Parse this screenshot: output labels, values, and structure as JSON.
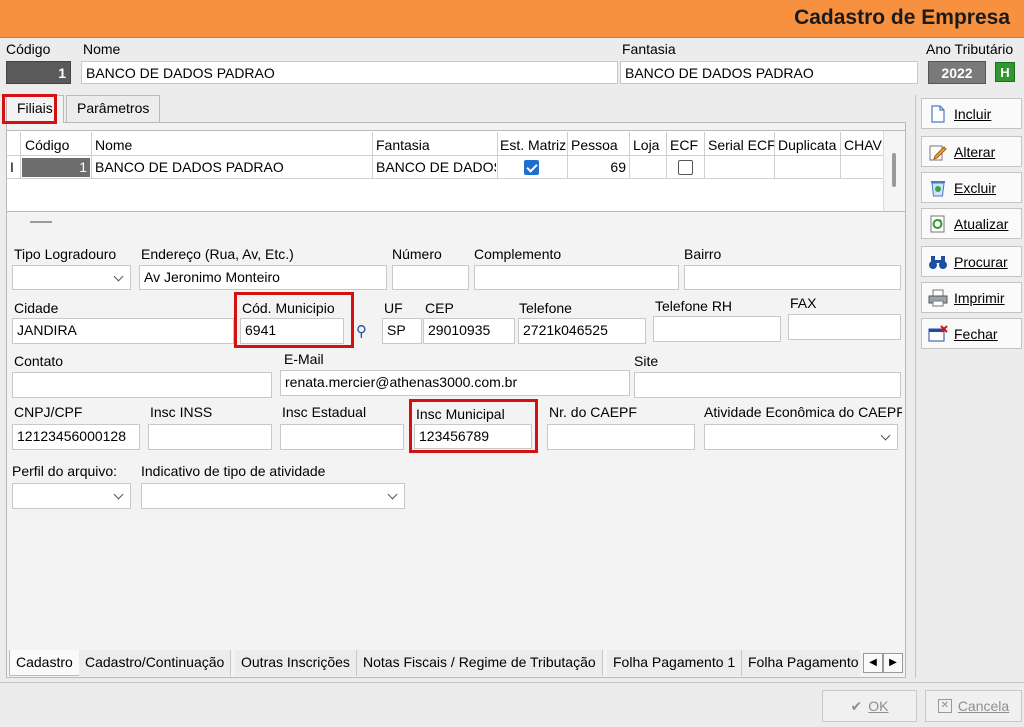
{
  "window": {
    "title": "Cadastro de Empresa"
  },
  "header": {
    "codigo_label": "Código",
    "codigo_value": "1",
    "nome_label": "Nome",
    "nome_value": "BANCO DE DADOS PADRAO",
    "fantasia_label": "Fantasia",
    "fantasia_value": "BANCO DE DADOS PADRAO",
    "ano_label": "Ano Tributário",
    "ano_value": "2022",
    "ano_btn": "H"
  },
  "tabs_top": [
    {
      "label": "Filiais"
    },
    {
      "label": "Parâmetros"
    }
  ],
  "grid": {
    "columns": [
      "Código",
      "Nome",
      "Fantasia",
      "Est. Matriz",
      "Pessoa",
      "Loja",
      "ECF",
      "Serial ECF",
      "Duplicata",
      "CHAV"
    ],
    "row": {
      "indicator": "I",
      "codigo": "1",
      "nome": "BANCO DE DADOS PADRAO",
      "fantasia": "BANCO DE DADOS",
      "est_matriz": true,
      "pessoa": "69",
      "loja": "",
      "ecf": false
    }
  },
  "form": {
    "tipo_logradouro_label": "Tipo Logradouro",
    "tipo_logradouro_value": "",
    "endereco_label": "Endereço (Rua, Av,  Etc.)",
    "endereco_value": "Av Jeronimo Monteiro",
    "numero_label": "Número",
    "numero_value": "",
    "complemento_label": "Complemento",
    "complemento_value": "",
    "bairro_label": "Bairro",
    "bairro_value": "",
    "cidade_label": "Cidade",
    "cidade_value": "JANDIRA",
    "cod_municipio_label": "Cód. Municipio",
    "cod_municipio_value": "6941",
    "uf_label": "UF",
    "uf_value": "SP",
    "cep_label": "CEP",
    "cep_value": "29010935",
    "telefone_label": "Telefone",
    "telefone_value": "2721k046525",
    "telefone_rh_label": "Telefone RH",
    "telefone_rh_value": "",
    "fax_label": "FAX",
    "fax_value": "",
    "contato_label": "Contato",
    "contato_value": "",
    "email_label": "E-Mail",
    "email_value": "renata.mercier@athenas3000.com.br",
    "site_label": "Site",
    "site_value": "",
    "cnpj_label": "CNPJ/CPF",
    "cnpj_value": "12123456000128",
    "inss_label": "Insc INSS",
    "inss_value": "",
    "estadual_label": "Insc Estadual",
    "estadual_value": "",
    "municipal_label": "Insc Municipal",
    "municipal_value": "123456789",
    "caepf_label": "Nr. do CAEPF",
    "caepf_value": "",
    "atividade_label": "Atividade Econômica do CAEPF",
    "perfil_label": "Perfil do arquivo:",
    "indicativo_label": "Indicativo de tipo de atividade"
  },
  "bottom_tabs": [
    {
      "label": "Cadastro"
    },
    {
      "label": "Cadastro/Continuação"
    },
    {
      "label": "Outras Inscrições"
    },
    {
      "label": "Notas Fiscais / Regime de Tributação"
    },
    {
      "label": "Folha Pagamento 1"
    },
    {
      "label": "Folha Pagamento"
    }
  ],
  "side_buttons": {
    "incluir": "Incluir",
    "alterar": "Alterar",
    "excluir": "Excluir",
    "atualizar": "Atualizar",
    "procurar": "Procurar",
    "imprimir": "Imprimir",
    "fechar": "Fechar"
  },
  "footer": {
    "ok": "OK",
    "cancela": "Cancela"
  },
  "colors": {
    "title_bar": "#f7913f",
    "highlight": "#d41111",
    "check": "#1d6fd0"
  }
}
